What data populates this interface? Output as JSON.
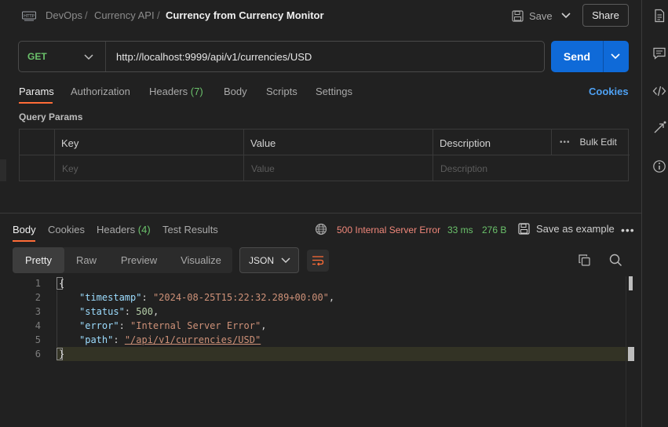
{
  "header": {
    "breadcrumb": [
      "DevOps",
      "Currency API",
      "Currency from Currency Monitor"
    ],
    "separator": "/",
    "save_label": "Save",
    "share_label": "Share"
  },
  "request": {
    "method": "GET",
    "url": "http://localhost:9999/api/v1/currencies/USD",
    "send_label": "Send"
  },
  "request_tabs": {
    "params": "Params",
    "authorization": "Authorization",
    "headers": "Headers",
    "headers_count": "(7)",
    "body": "Body",
    "scripts": "Scripts",
    "settings": "Settings",
    "cookies": "Cookies"
  },
  "query_params": {
    "title": "Query Params",
    "columns": [
      "Key",
      "Value",
      "Description"
    ],
    "placeholders": [
      "Key",
      "Value",
      "Description"
    ],
    "bulk_edit": "Bulk Edit"
  },
  "response_tabs": {
    "body": "Body",
    "cookies": "Cookies",
    "headers": "Headers",
    "headers_count": "(4)",
    "test_results": "Test Results"
  },
  "response_status": {
    "status": "500 Internal Server Error",
    "time": "33 ms",
    "size": "276 B",
    "save_example": "Save as example"
  },
  "view_modes": [
    "Pretty",
    "Raw",
    "Preview",
    "Visualize"
  ],
  "active_view_mode": "Pretty",
  "format": "JSON",
  "response_body": {
    "line_numbers": [
      "1",
      "2",
      "3",
      "4",
      "5",
      "6"
    ],
    "open_brace": "{",
    "close_brace": "}",
    "timestamp_key": "\"timestamp\"",
    "timestamp_value": "\"2024-08-25T15:22:32.289+00:00\"",
    "status_key": "\"status\"",
    "status_value": "500",
    "error_key": "\"error\"",
    "error_value": "\"Internal Server Error\"",
    "path_key": "\"path\"",
    "path_value": "\"/api/v1/currencies/USD\""
  },
  "colors": {
    "accent": "#ff6c37",
    "send_button": "#0f6ad8",
    "method": "#6bc26b",
    "error_status": "#f0877a",
    "link": "#4ea1f3"
  },
  "icons": {
    "http_request": "http-icon",
    "save": "floppy-icon",
    "globe": "globe-icon",
    "copy": "copy-icon",
    "search": "search-icon",
    "wrap": "wrap-lines-icon",
    "right_sidebar": [
      "document-icon",
      "comment-icon",
      "code-icon",
      "related-icon",
      "info-icon"
    ]
  }
}
